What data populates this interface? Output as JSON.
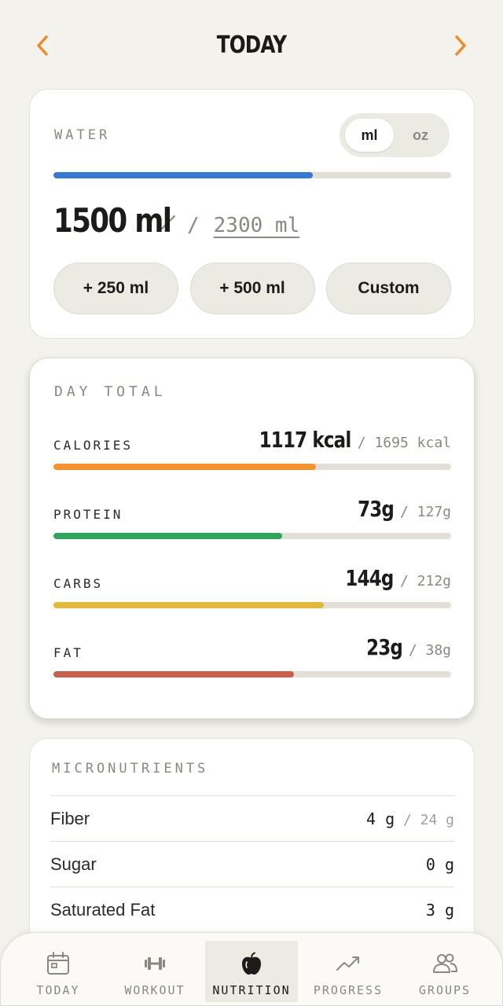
{
  "header": {
    "title": "TODAY",
    "accent_color": "#ee8a2c"
  },
  "water": {
    "label": "WATER",
    "units": [
      "ml",
      "oz"
    ],
    "selected_unit": "ml",
    "current": "1500 ml",
    "slash": "/",
    "goal": "2300 ml",
    "progress": 0.652,
    "bar_color": "#3678d8",
    "buttons": [
      "+ 250 ml",
      "+ 500 ml",
      "Custom"
    ]
  },
  "day_total": {
    "label": "DAY TOTAL",
    "macros": [
      {
        "name": "CALORIES",
        "current": "1117 kcal",
        "goal": "/ 1695 kcal",
        "progress": 0.66,
        "color": "#f5922c"
      },
      {
        "name": "PROTEIN",
        "current": "73g",
        "goal": "/ 127g",
        "progress": 0.575,
        "color": "#2fa55a"
      },
      {
        "name": "CARBS",
        "current": "144g",
        "goal": "/ 212g",
        "progress": 0.68,
        "color": "#e5b83a"
      },
      {
        "name": "FAT",
        "current": "23g",
        "goal": "/ 38g",
        "progress": 0.605,
        "color": "#c8604a"
      }
    ]
  },
  "micronutrients": {
    "label": "MICRONUTRIENTS",
    "rows": [
      {
        "name": "Fiber",
        "current": "4 g",
        "goal": " / 24 g"
      },
      {
        "name": "Sugar",
        "current": "0 g",
        "goal": ""
      },
      {
        "name": "Saturated Fat",
        "current": "3 g",
        "goal": ""
      }
    ]
  },
  "bottom_nav": {
    "items": [
      {
        "label": "TODAY",
        "icon": "calendar-icon",
        "active": false
      },
      {
        "label": "WORKOUT",
        "icon": "dumbbell-icon",
        "active": false
      },
      {
        "label": "NUTRITION",
        "icon": "apple-icon",
        "active": true
      },
      {
        "label": "PROGRESS",
        "icon": "trend-up-icon",
        "active": false
      },
      {
        "label": "GROUPS",
        "icon": "users-icon",
        "active": false
      }
    ]
  }
}
